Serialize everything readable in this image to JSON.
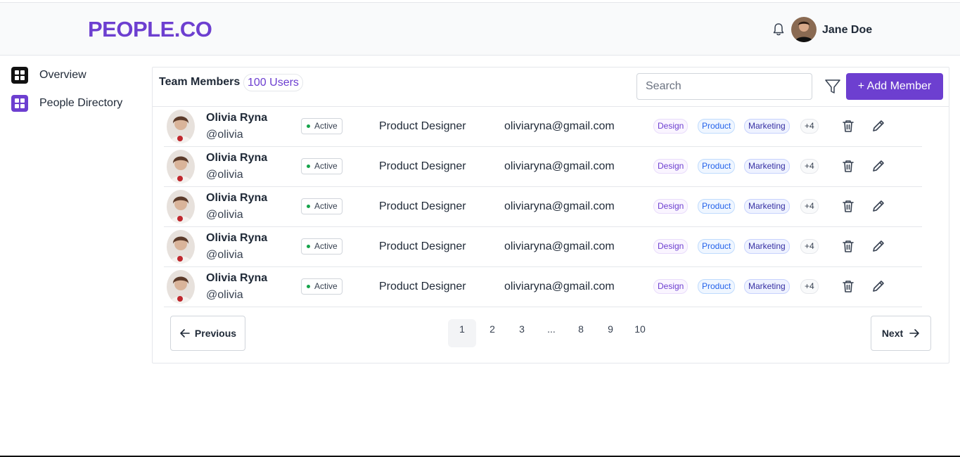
{
  "header": {
    "brand": "PEOPLE.CO",
    "user_name": "Jane Doe"
  },
  "sidebar": {
    "items": [
      {
        "label": "Overview"
      },
      {
        "label": "People Directory"
      }
    ]
  },
  "team": {
    "title": "Team Members",
    "count": "100 Users",
    "search_placeholder": "Search",
    "add_label": "+ Add Member",
    "members": [
      {
        "name": "Olivia Ryna",
        "handle": "@olivia",
        "status": "Active",
        "role": "Product Designer",
        "email": "oliviaryna@gmail.com",
        "tags": [
          "Design",
          "Product",
          "Marketing",
          "+4"
        ]
      },
      {
        "name": "Olivia Ryna",
        "handle": "@olivia",
        "status": "Active",
        "role": "Product Designer",
        "email": "oliviaryna@gmail.com",
        "tags": [
          "Design",
          "Product",
          "Marketing",
          "+4"
        ]
      },
      {
        "name": "Olivia Ryna",
        "handle": "@olivia",
        "status": "Active",
        "role": "Product Designer",
        "email": "oliviaryna@gmail.com",
        "tags": [
          "Design",
          "Product",
          "Marketing",
          "+4"
        ]
      },
      {
        "name": "Olivia Ryna",
        "handle": "@olivia",
        "status": "Active",
        "role": "Product Designer",
        "email": "oliviaryna@gmail.com",
        "tags": [
          "Design",
          "Product",
          "Marketing",
          "+4"
        ]
      },
      {
        "name": "Olivia Ryna",
        "handle": "@olivia",
        "status": "Active",
        "role": "Product Designer",
        "email": "oliviaryna@gmail.com",
        "tags": [
          "Design",
          "Product",
          "Marketing",
          "+4"
        ]
      }
    ]
  },
  "pagination": {
    "previous": "Previous",
    "next": "Next",
    "pages": [
      "1",
      "2",
      "3",
      "...",
      "8",
      "9",
      "10"
    ],
    "current": "1"
  },
  "colors": {
    "brand": "#6d3fd0",
    "active_dot": "#16a34a"
  },
  "icons": [
    "bell-icon",
    "avatar",
    "grid-icon",
    "filter-icon",
    "trash-icon",
    "edit-icon",
    "arrow-left-icon",
    "arrow-right-icon"
  ]
}
